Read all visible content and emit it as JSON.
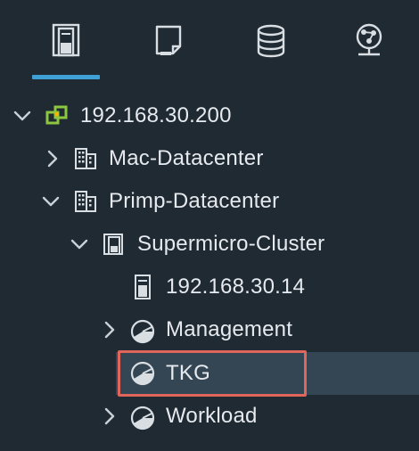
{
  "tabs": [
    {
      "name": "hosts-clusters",
      "icon": "hosts-clusters-icon",
      "active": true
    },
    {
      "name": "vms-templates",
      "icon": "vms-templates-icon",
      "active": false
    },
    {
      "name": "storage",
      "icon": "database-icon",
      "active": false
    },
    {
      "name": "networking",
      "icon": "network-globe-icon",
      "active": false
    }
  ],
  "tree": {
    "vcenter": {
      "label": "192.168.30.200",
      "icon": "vcenter-icon",
      "expanded": true
    },
    "mac_dc": {
      "label": "Mac-Datacenter",
      "icon": "datacenter-icon",
      "expanded": false
    },
    "primp_dc": {
      "label": "Primp-Datacenter",
      "icon": "datacenter-icon",
      "expanded": true
    },
    "cluster": {
      "label": "Supermicro-Cluster",
      "icon": "cluster-icon",
      "expanded": true
    },
    "host": {
      "label": "192.168.30.14",
      "icon": "host-icon"
    },
    "management": {
      "label": "Management",
      "icon": "resource-pool-icon",
      "expanded": false
    },
    "tkg": {
      "label": "TKG",
      "icon": "resource-pool-icon",
      "selected": true
    },
    "workload": {
      "label": "Workload",
      "icon": "resource-pool-icon",
      "expanded": false
    }
  },
  "colors": {
    "background": "#1f2a33",
    "accent": "#3fa0d6",
    "selection": "#344654",
    "highlight": "#e0655a",
    "vcenter_green": "#8dc63f"
  }
}
